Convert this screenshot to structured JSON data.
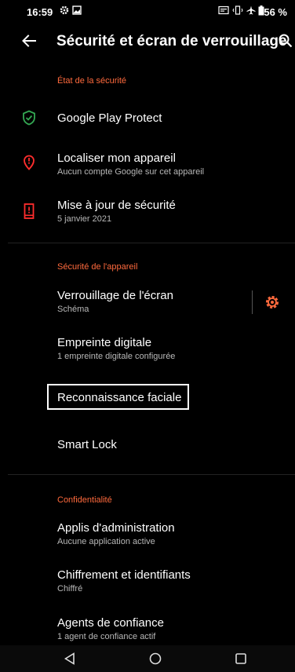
{
  "status_bar": {
    "time": "16:59",
    "battery": "56 %",
    "icons": [
      "settings-gear-icon",
      "image-icon",
      "network-icon",
      "vibrate-icon",
      "airplane-icon",
      "battery-icon"
    ]
  },
  "app_bar": {
    "back_icon": "arrow-back-icon",
    "title": "Sécurité et écran de verrouillage",
    "search_icon": "search-icon"
  },
  "sections": {
    "security_status": "État de la sécurité",
    "device_security": "Sécurité de l'appareil",
    "privacy": "Confidentialité"
  },
  "items": {
    "play_protect": {
      "title": "Google Play Protect",
      "icon": "shield-check-icon",
      "color": "#34a853"
    },
    "find_device": {
      "title": "Localiser mon appareil",
      "subtitle": "Aucun compte Google sur cet appareil",
      "icon": "location-alert-icon",
      "color": "#ff2d2d"
    },
    "security_update": {
      "title": "Mise à jour de sécurité",
      "subtitle": "5 janvier 2021",
      "icon": "phone-alert-icon",
      "color": "#ff2d2d"
    },
    "screen_lock": {
      "title": "Verrouillage de l'écran",
      "subtitle": "Schéma"
    },
    "fingerprint": {
      "title": "Empreinte digitale",
      "subtitle": "1 empreinte digitale configurée"
    },
    "face_recognition": {
      "title": "Reconnaissance faciale"
    },
    "smart_lock": {
      "title": "Smart Lock"
    },
    "device_admin": {
      "title": "Applis d'administration",
      "subtitle": "Aucune application active"
    },
    "encryption": {
      "title": "Chiffrement et identifiants",
      "subtitle": "Chiffré"
    },
    "trust_agents": {
      "title": "Agents de confiance",
      "subtitle": "1 agent de confiance actif"
    }
  },
  "nav_bar": {
    "back": "nav-back-icon",
    "home": "nav-home-icon",
    "recents": "nav-recents-icon"
  },
  "colors": {
    "accent": "#ff6a3d",
    "background": "#000000"
  }
}
